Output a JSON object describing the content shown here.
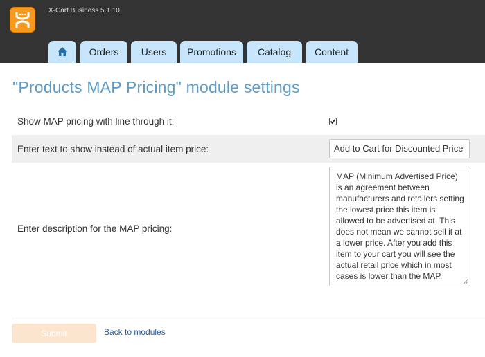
{
  "header": {
    "app_title": "X-Cart Business 5.1.10",
    "logo_icon": "xcart-logo-icon",
    "brand_color": "#f59a1e"
  },
  "tabs": [
    {
      "label": "",
      "icon": "home-icon"
    },
    {
      "label": "Orders"
    },
    {
      "label": "Users"
    },
    {
      "label": "Promotions"
    },
    {
      "label": "Catalog"
    },
    {
      "label": "Content"
    }
  ],
  "page": {
    "title": "\"Products MAP Pricing\" module settings"
  },
  "settings": [
    {
      "label": "Show MAP pricing with line through it:",
      "type": "checkbox",
      "checked": true
    },
    {
      "label": "Enter text to show instead of actual item price:",
      "type": "text",
      "value": "Add to Cart for Discounted Price"
    },
    {
      "label": "Enter description for the MAP pricing:",
      "type": "textarea",
      "value": "MAP (Minimum Advertised Price) is an agreement between manufacturers and retailers setting the lowest price this item is allowed to be advertised at. This does not mean we cannot sell it at a lower price. After you add this item to your cart you will see the actual retail price which in most cases is lower than the MAP."
    }
  ],
  "footer": {
    "submit_label": "Submit",
    "back_link": "Back to modules"
  },
  "colors": {
    "header_bg": "#333333",
    "tab_bg": "#c8e6fb",
    "title_color": "#5e9bc6",
    "link_color": "#2a5ea8"
  }
}
